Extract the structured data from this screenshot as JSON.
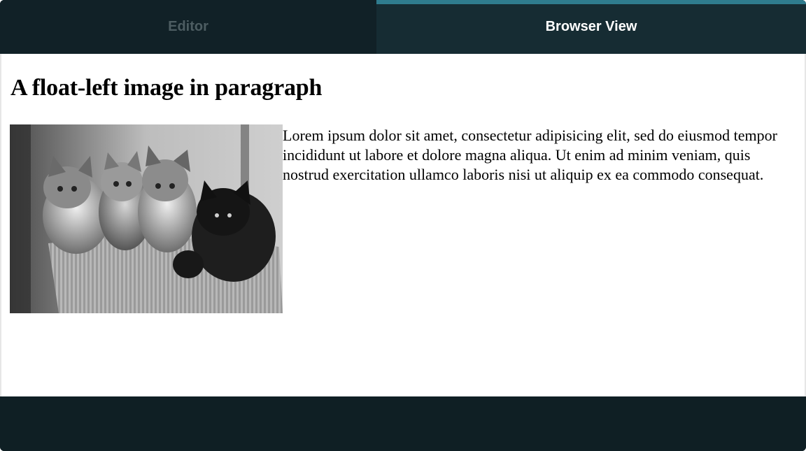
{
  "tabs": {
    "editor_label": "Editor",
    "browser_label": "Browser View",
    "active": "Browser View"
  },
  "page": {
    "heading": "A float-left image in paragraph",
    "paragraph": "Lorem ipsum dolor sit amet, consectetur adipisicing elit, sed do eiusmod tempor incididunt ut labore et dolore magna aliqua. Ut enim ad minim veniam, quis nostrud exercitation ullamco laboris nisi ut aliquip ex ea commodo consequat."
  },
  "colors": {
    "chrome_dark": "#0f1f24",
    "active_tab_bg": "#162c33",
    "active_tab_accent": "#2f7c8e",
    "inactive_tab_text": "#4d5d62"
  },
  "icons": {
    "image": "kittens-photo"
  }
}
